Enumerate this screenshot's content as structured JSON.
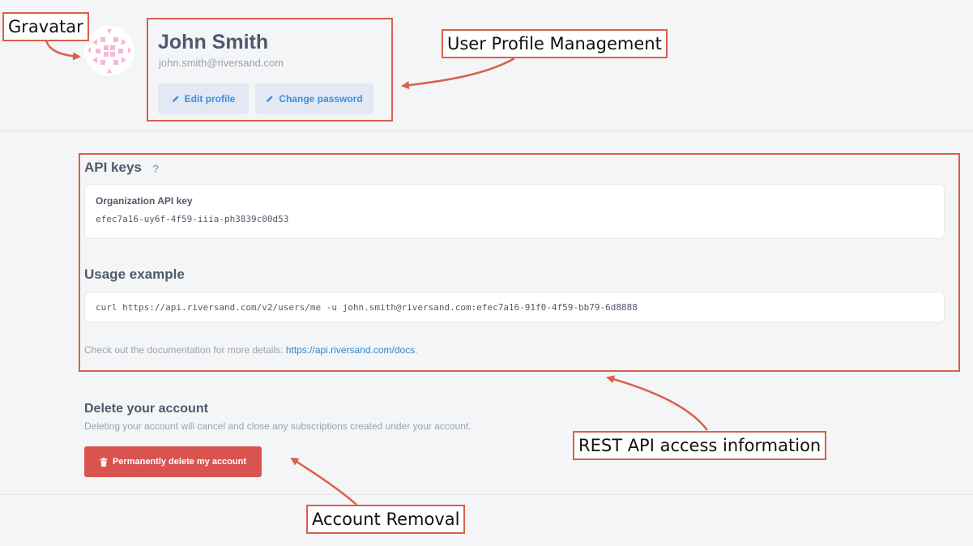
{
  "profile": {
    "name": "John Smith",
    "email": "john.smith@riversand.com",
    "edit_label": "Edit profile",
    "password_label": "Change password"
  },
  "api": {
    "title": "API keys",
    "help": "?",
    "key_label": "Organization API key",
    "key_value": "efec7a16-uy6f-4f59-iiia-ph3839c00d53",
    "usage_title": "Usage example",
    "usage_code": "curl https://api.riversand.com/v2/users/me -u john.smith@riversand.com:efec7a16-91f0-4f59-bb79-6d8888",
    "docs_text": "Check out the documentation for more details: ",
    "docs_link": "https://api.riversand.com/docs",
    "docs_end": "."
  },
  "delete": {
    "title": "Delete your account",
    "description": "Deleting your account will cancel and close any subscriptions created under your account.",
    "button_label": "Permanently delete my account"
  },
  "annotations": {
    "gravatar": "Gravatar",
    "profile": "User Profile Management",
    "api": "REST API access information",
    "removal": "Account Removal"
  },
  "colors": {
    "accent": "#3d8ee0",
    "danger": "#d9534f",
    "annotation": "#d9604a",
    "gravatar": "#f7b6d6"
  },
  "icons": {
    "edit": "pencil-icon",
    "password": "pencil-icon",
    "delete": "trash-icon",
    "help": "question-icon"
  }
}
